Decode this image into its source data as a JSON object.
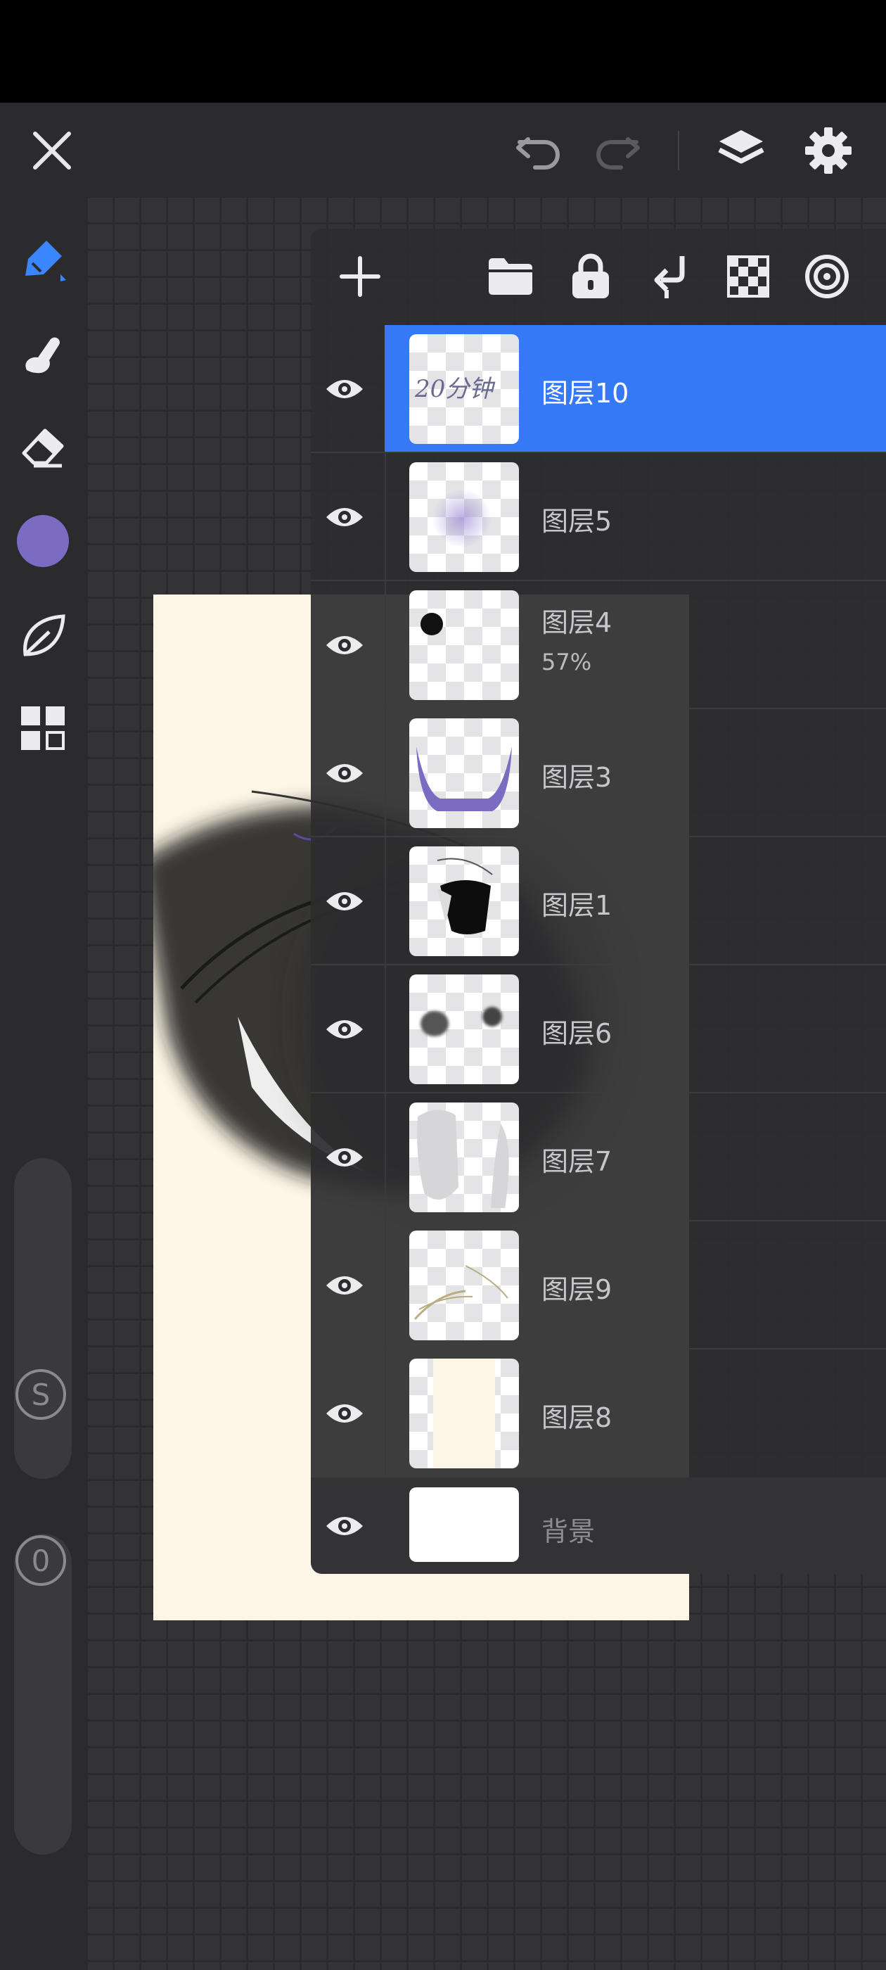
{
  "app": {
    "top_toolbar": {
      "close": "close-icon",
      "undo": "undo-icon",
      "redo": "redo-icon",
      "layers": "layers-icon",
      "settings": "gear-icon"
    },
    "tools": [
      {
        "name": "brush",
        "icon": "brush-icon",
        "active": true
      },
      {
        "name": "smudge",
        "icon": "smudge-icon"
      },
      {
        "name": "eraser",
        "icon": "eraser-icon"
      },
      {
        "name": "color",
        "icon": "color-swatch",
        "color": "#7b6bc3"
      },
      {
        "name": "leaf",
        "icon": "leaf-icon"
      },
      {
        "name": "grid",
        "icon": "grid-icon"
      }
    ],
    "size_badge": "S",
    "opacity_badge": "0",
    "accent_color": "#3579f6"
  },
  "layers_panel": {
    "toolbar": [
      "add-icon",
      "folder-icon",
      "lock-icon",
      "merge-down-icon",
      "checker-icon",
      "reference-icon"
    ],
    "layers": [
      {
        "name": "图层10",
        "selected": true,
        "thumb_text": "20分钟"
      },
      {
        "name": "图层5"
      },
      {
        "name": "图层4",
        "opacity": "57%"
      },
      {
        "name": "图层3"
      },
      {
        "name": "图层1"
      },
      {
        "name": "图层6"
      },
      {
        "name": "图层7"
      },
      {
        "name": "图层9"
      },
      {
        "name": "图层8"
      },
      {
        "name": "背景"
      }
    ]
  }
}
